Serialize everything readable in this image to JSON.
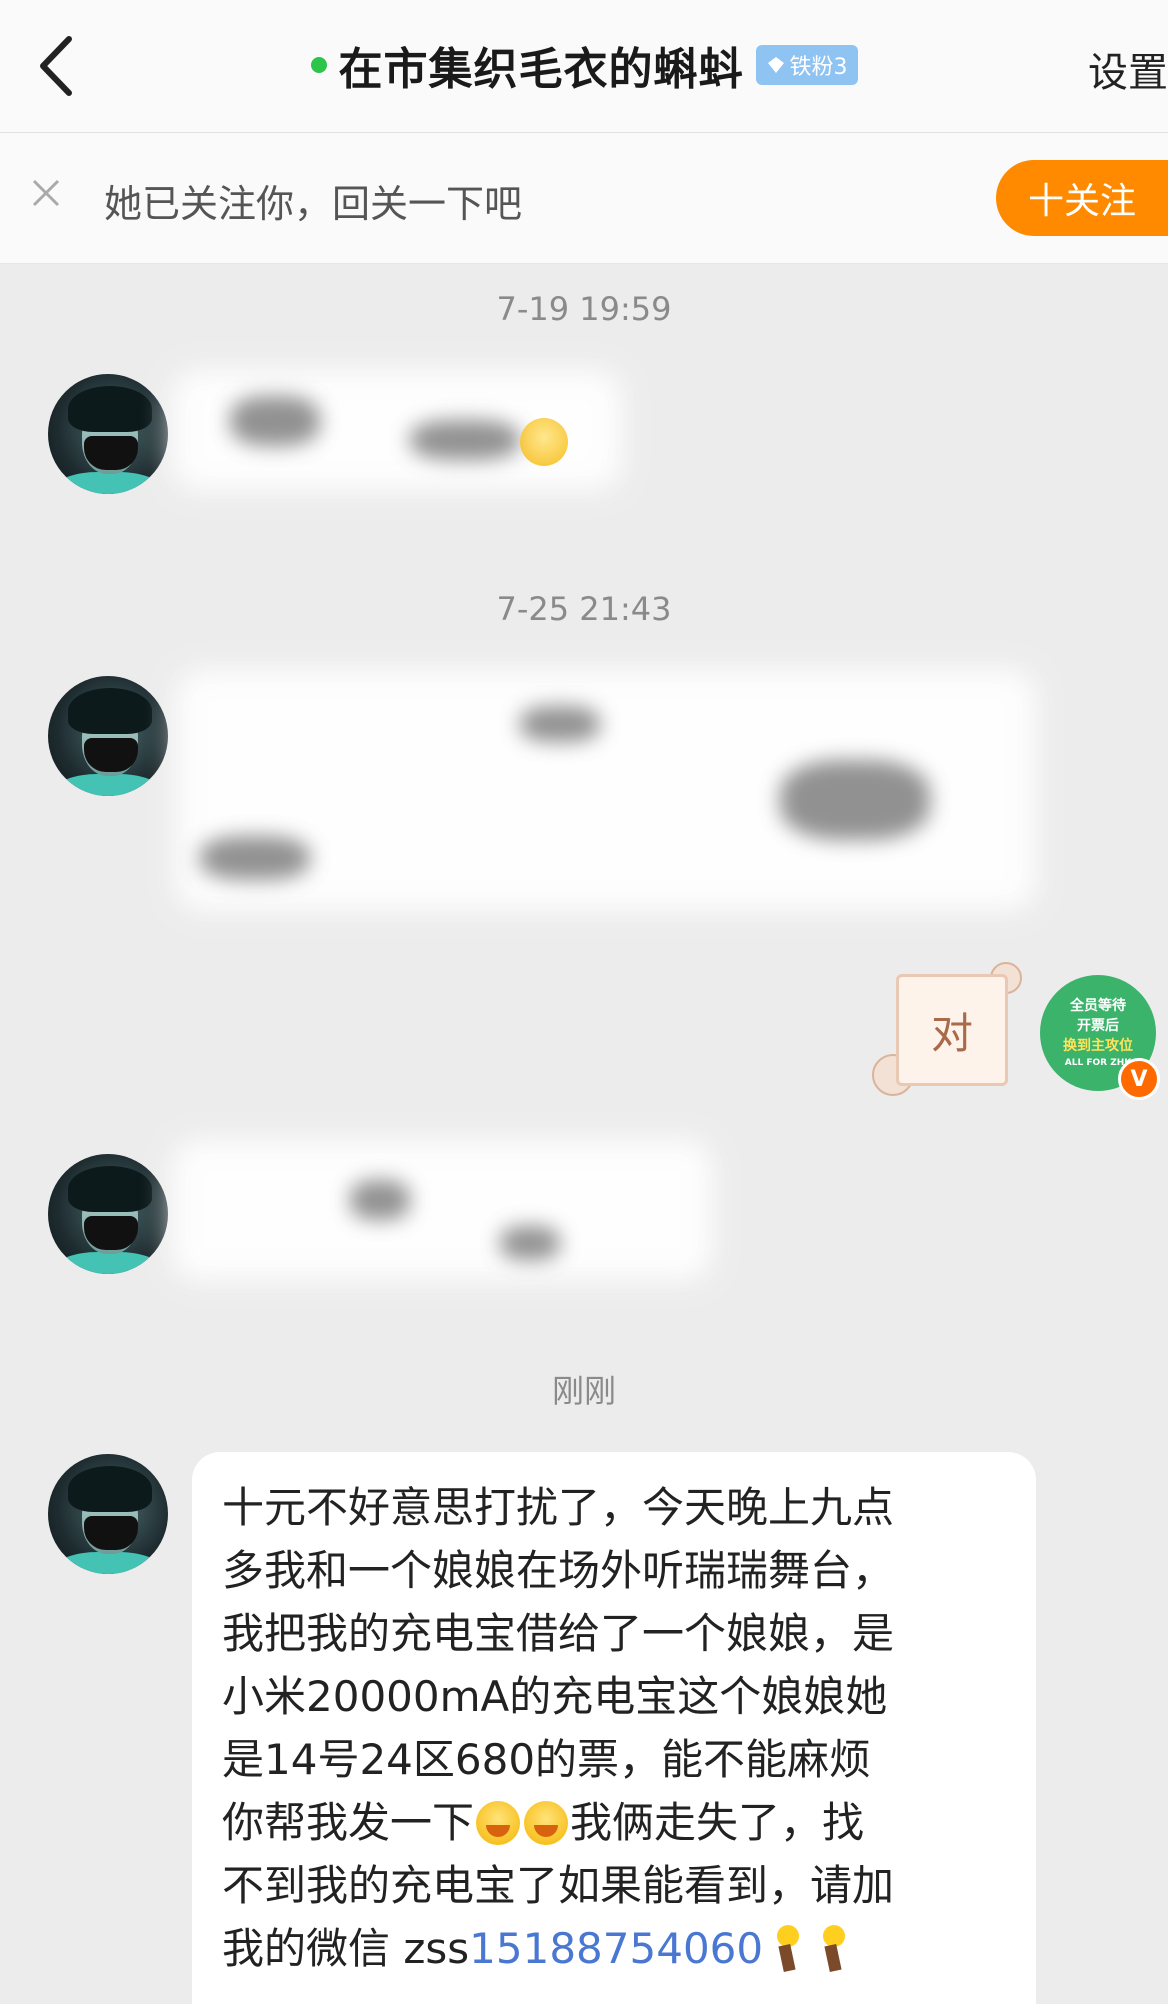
{
  "header": {
    "title": "在市集织毛衣的蝌蚪",
    "badge": "铁粉3",
    "settings_label": "设置"
  },
  "follow_banner": {
    "text": "她已关注你，回关一下吧",
    "button_label": "十关注"
  },
  "chat": {
    "timestamps": [
      "7-19 19:59",
      "7-25 21:43",
      "刚刚"
    ],
    "sticker_text": "对",
    "me_avatar_lines": [
      "全员等待",
      "开票后",
      "换到主攻位",
      "ALL FOR ZHK"
    ],
    "last_message": {
      "line1": "十元不好意思打扰了，今天晚上九点",
      "line2": "多我和一个娘娘在场外听瑞瑞舞台，",
      "line3": "我把我的充电宝借给了一个娘娘，是",
      "line4": "小米20000mA的充电宝这个娘娘她",
      "line5": "是14号24区680的票，能不能麻烦",
      "line6a": "你帮我发一下",
      "line6b": "我俩走失了，找",
      "line7": "不到我的充电宝了如果能看到，请加",
      "line8a": "我的微信 zss",
      "phone": "15188754060"
    }
  },
  "colors": {
    "accent_orange": "#ff8a00",
    "online_green": "#2dc44a",
    "link_blue": "#4a77d1"
  }
}
